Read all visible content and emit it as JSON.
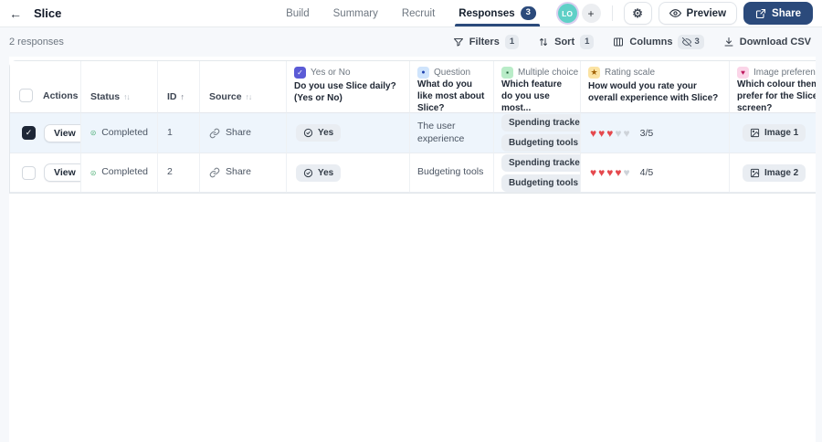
{
  "navbar": {
    "title": "Slice",
    "tabs": [
      {
        "label": "Build"
      },
      {
        "label": "Summary"
      },
      {
        "label": "Recruit"
      },
      {
        "label": "Responses",
        "badge": "3",
        "active": true
      }
    ],
    "avatar_initials": "LO",
    "preview_label": "Preview",
    "share_label": "Share"
  },
  "toolbar": {
    "responses_count": "2 responses",
    "filters": {
      "label": "Filters",
      "badge": "1"
    },
    "sort": {
      "label": "Sort",
      "badge": "1"
    },
    "columns": {
      "label": "Columns",
      "badge": "3"
    },
    "download": {
      "label": "Download CSV"
    }
  },
  "table": {
    "columns": [
      {
        "label": "Actions"
      },
      {
        "label": "Status"
      },
      {
        "label": "ID"
      },
      {
        "label": "Source"
      },
      {
        "type": "Yes or No",
        "question": "Do you use Slice daily? (Yes or No)"
      },
      {
        "type": "Question",
        "question": "What do you like most about Slice?"
      },
      {
        "type": "Multiple choice",
        "question": "Which feature do you use most..."
      },
      {
        "type": "Rating scale",
        "question": "How would you rate your overall experience with Slice?"
      },
      {
        "type": "Image preference",
        "question": "Which colour theme do you prefer for the Slice app's home screen?"
      }
    ],
    "rows": [
      {
        "selected": true,
        "view_label": "View",
        "status": "Completed",
        "id": "1",
        "source": "Share",
        "q_yes_no": "Yes",
        "q_text": "The user experience",
        "q_choices": [
          "Spending tracker",
          "Budgeting tools"
        ],
        "q_rating": {
          "filled": 3,
          "total": 5,
          "label": "3/5"
        },
        "q_image": "Image 1"
      },
      {
        "selected": false,
        "view_label": "View",
        "status": "Completed",
        "id": "2",
        "source": "Share",
        "q_yes_no": "Yes",
        "q_text": "Budgeting tools",
        "q_choices": [
          "Spending tracker",
          "Budgeting tools"
        ],
        "q_rating": {
          "filled": 4,
          "total": 5,
          "label": "4/5"
        },
        "q_image": "Image 2"
      }
    ]
  },
  "icons": {
    "back": "←",
    "gear": "⚙",
    "plus": "+",
    "check": "✓",
    "heart": "♥",
    "star": "★",
    "dot": "●",
    "square": "▪",
    "sort_up": "↑",
    "sort_down": "↓",
    "sort_both": "↑↓"
  },
  "colors": {
    "accent_navy": "#2b4a7b",
    "selected_row": "#eef5fc",
    "heart_red": "#e5484d",
    "completed_green": "#34a361",
    "avatar_teal": "#5fd0c7"
  }
}
